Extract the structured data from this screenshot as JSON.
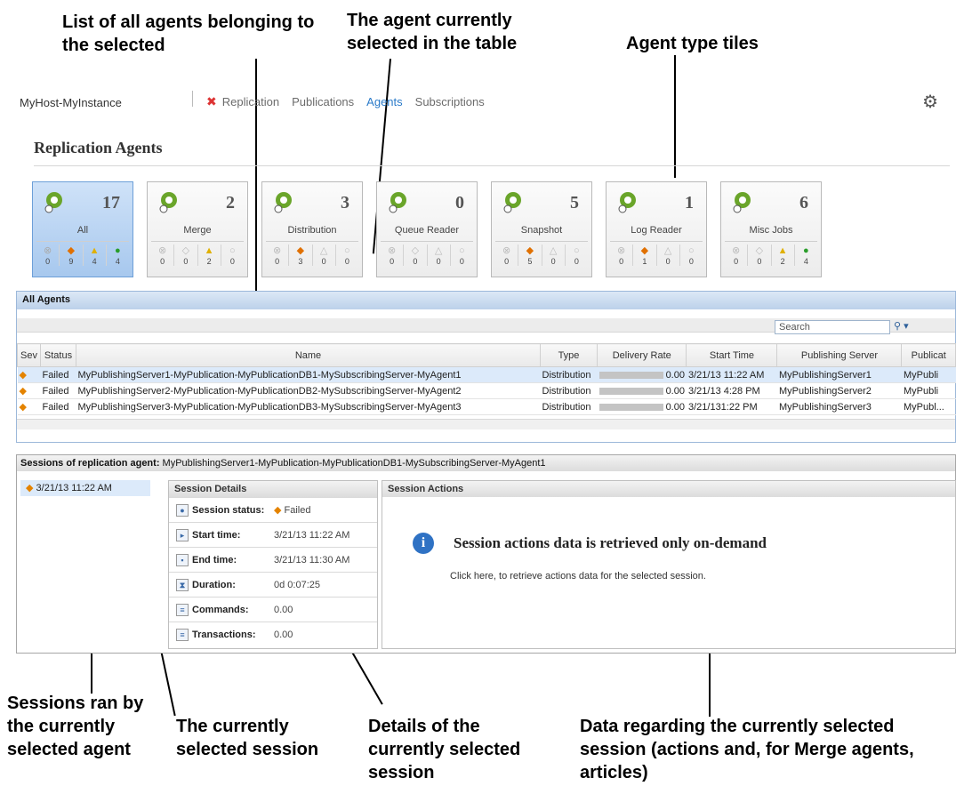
{
  "annotations": {
    "agents_list": "List of all agents belonging to the selected",
    "selected_agent": "The agent currently selected in the table",
    "tiles": "Agent type tiles",
    "sessions": "Sessions ran by the currently selected agent",
    "current_session": "The currently selected session",
    "details": "Details of the currently selected session",
    "data": "Data regarding the currently selected session (actions and, for Merge agents, articles)"
  },
  "header": {
    "host": "MyHost-MyInstance",
    "nav": [
      "Replication",
      "Publications",
      "Agents",
      "Subscriptions"
    ],
    "active_nav": "Agents"
  },
  "page": {
    "title": "Replication Agents"
  },
  "tiles": [
    {
      "label": "All",
      "count": "17",
      "stats": [
        "0",
        "9",
        "4",
        "4"
      ]
    },
    {
      "label": "Merge",
      "count": "2",
      "stats": [
        "0",
        "0",
        "2",
        "0"
      ]
    },
    {
      "label": "Distribution",
      "count": "3",
      "stats": [
        "0",
        "3",
        "0",
        "0"
      ]
    },
    {
      "label": "Queue Reader",
      "count": "0",
      "stats": [
        "0",
        "0",
        "0",
        "0"
      ]
    },
    {
      "label": "Snapshot",
      "count": "5",
      "stats": [
        "0",
        "5",
        "0",
        "0"
      ]
    },
    {
      "label": "Log Reader",
      "count": "1",
      "stats": [
        "0",
        "1",
        "0",
        "0"
      ]
    },
    {
      "label": "Misc Jobs",
      "count": "6",
      "stats": [
        "0",
        "0",
        "2",
        "4"
      ]
    }
  ],
  "all_agents": {
    "title": "All Agents",
    "search_placeholder": "Search",
    "columns": [
      "Sev",
      "Status",
      "Name",
      "Type",
      "Delivery Rate",
      "Start Time",
      "Publishing Server",
      "Publicat"
    ],
    "rows": [
      {
        "status": "Failed",
        "name": "MyPublishingServer1-MyPublication-MyPublicationDB1-MySubscribingServer-MyAgent1",
        "type": "Distribution",
        "rate": "0.00",
        "start": "3/21/13 11:22 AM",
        "server": "MyPublishingServer1",
        "pub": "MyPubli"
      },
      {
        "status": "Failed",
        "name": "MyPublishingServer2-MyPublication-MyPublicationDB2-MySubscribingServer-MyAgent2",
        "type": "Distribution",
        "rate": "0.00",
        "start": "3/21/13 4:28 PM",
        "server": "MyPublishingServer2",
        "pub": "MyPubli"
      },
      {
        "status": "Failed",
        "name": "MyPublishingServer3-MyPublication-MyPublicationDB3-MySubscribingServer-MyAgent3",
        "type": "Distribution",
        "rate": "0.00",
        "start": "3/21/131:22 PM",
        "server": "MyPublishingServer3",
        "pub": "MyPubl..."
      }
    ]
  },
  "sessions": {
    "label": "Sessions of replication agent:",
    "agent": "MyPublishingServer1-MyPublication-MyPublicationDB1-MySubscribingServer-MyAgent1",
    "selected_session": "3/21/13 11:22 AM",
    "details_title": "Session Details",
    "details": [
      {
        "key": "Session status:",
        "value": "Failed"
      },
      {
        "key": "Start time:",
        "value": "3/21/13 11:22 AM"
      },
      {
        "key": "End time:",
        "value": "3/21/13 11:30 AM"
      },
      {
        "key": "Duration:",
        "value": "0d 0:07:25"
      },
      {
        "key": "Commands:",
        "value": "0.00"
      },
      {
        "key": "Transactions:",
        "value": "0.00"
      }
    ],
    "actions_title": "Session Actions",
    "actions_message": "Session actions data is retrieved only on-demand",
    "actions_link": "Click here, to retrieve actions data for the selected session."
  }
}
